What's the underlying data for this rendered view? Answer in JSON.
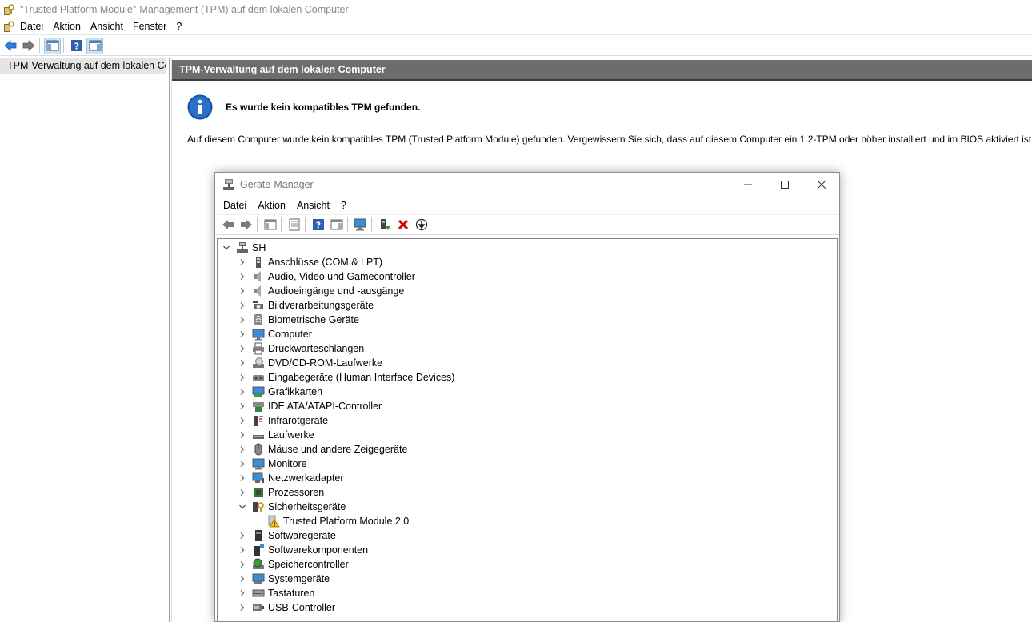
{
  "window": {
    "title": "\"Trusted Platform Module\"-Management (TPM) auf dem lokalen Computer",
    "menu": [
      "Datei",
      "Aktion",
      "Ansicht",
      "Fenster",
      "?"
    ]
  },
  "left_pane": {
    "root_item": "TPM-Verwaltung auf dem lokalen Computer"
  },
  "right_pane": {
    "header": "TPM-Verwaltung auf dem lokalen Computer",
    "info_title": "Es wurde kein kompatibles TPM gefunden.",
    "description": "Auf diesem Computer wurde kein kompatibles TPM (Trusted Platform Module) gefunden. Vergewissern Sie sich, dass auf diesem Computer ein 1.2-TPM oder höher installiert und im BIOS aktiviert ist."
  },
  "device_manager": {
    "title": "Geräte-Manager",
    "menu": [
      "Datei",
      "Aktion",
      "Ansicht",
      "?"
    ],
    "root": "SH",
    "categories": [
      {
        "label": "Anschlüsse (COM & LPT)",
        "icon": "port-icon",
        "expanded": false
      },
      {
        "label": "Audio, Video und Gamecontroller",
        "icon": "speaker-icon",
        "expanded": false
      },
      {
        "label": "Audioeingänge und -ausgänge",
        "icon": "speaker-icon",
        "expanded": false
      },
      {
        "label": "Bildverarbeitungsgeräte",
        "icon": "camera-icon",
        "expanded": false
      },
      {
        "label": "Biometrische Geräte",
        "icon": "fingerprint-icon",
        "expanded": false
      },
      {
        "label": "Computer",
        "icon": "monitor-icon",
        "expanded": false
      },
      {
        "label": "Druckwarteschlangen",
        "icon": "printer-icon",
        "expanded": false
      },
      {
        "label": "DVD/CD-ROM-Laufwerke",
        "icon": "disc-drive-icon",
        "expanded": false
      },
      {
        "label": "Eingabegeräte (Human Interface Devices)",
        "icon": "hid-icon",
        "expanded": false
      },
      {
        "label": "Grafikkarten",
        "icon": "display-adapter-icon",
        "expanded": false
      },
      {
        "label": "IDE ATA/ATAPI-Controller",
        "icon": "ide-controller-icon",
        "expanded": false
      },
      {
        "label": "Infrarotgeräte",
        "icon": "infrared-icon",
        "expanded": false
      },
      {
        "label": "Laufwerke",
        "icon": "disk-drive-icon",
        "expanded": false
      },
      {
        "label": "Mäuse und andere Zeigegeräte",
        "icon": "mouse-icon",
        "expanded": false
      },
      {
        "label": "Monitore",
        "icon": "monitor-icon",
        "expanded": false
      },
      {
        "label": "Netzwerkadapter",
        "icon": "network-adapter-icon",
        "expanded": false
      },
      {
        "label": "Prozessoren",
        "icon": "processor-icon",
        "expanded": false
      },
      {
        "label": "Sicherheitsgeräte",
        "icon": "security-device-icon",
        "expanded": true
      },
      {
        "label": "Trusted Platform Module 2.0",
        "icon": "warning-icon",
        "child": true
      },
      {
        "label": "Softwaregeräte",
        "icon": "software-device-icon",
        "expanded": false
      },
      {
        "label": "Softwarekomponenten",
        "icon": "software-component-icon",
        "expanded": false
      },
      {
        "label": "Speichercontroller",
        "icon": "storage-controller-icon",
        "expanded": false
      },
      {
        "label": "Systemgeräte",
        "icon": "system-device-icon",
        "expanded": false
      },
      {
        "label": "Tastaturen",
        "icon": "keyboard-icon",
        "expanded": false
      },
      {
        "label": "USB-Controller",
        "icon": "usb-icon",
        "expanded": false
      }
    ]
  },
  "colors": {
    "header_band": "#6d6d6d",
    "info_blue": "#1e5fb4",
    "remove_red": "#d40000",
    "warning_yellow": "#f5c400"
  }
}
